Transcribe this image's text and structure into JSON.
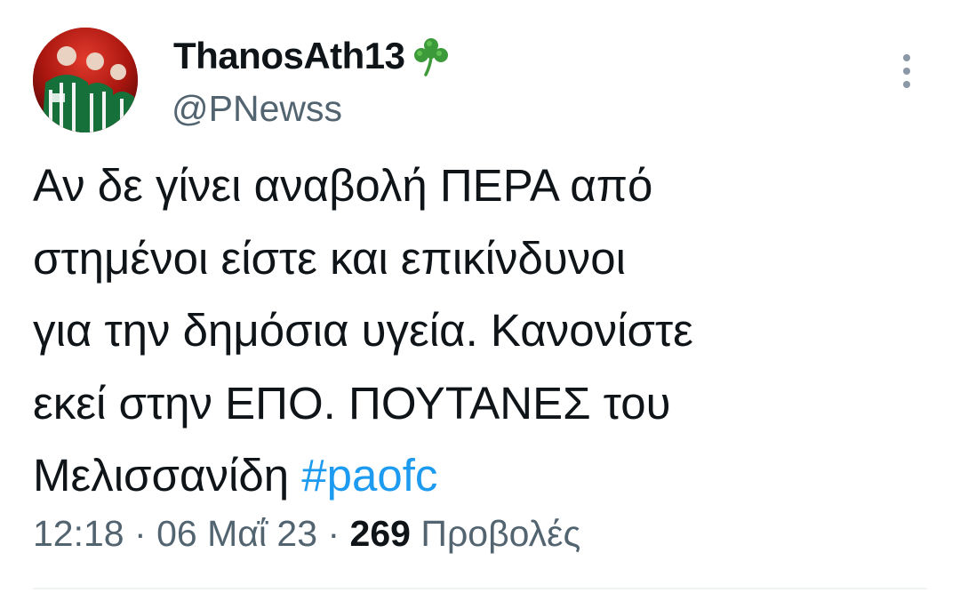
{
  "author": {
    "display_name": "ThanosAth13",
    "name_emoji": "shamrock-icon",
    "handle": "@PNewss"
  },
  "tweet": {
    "lines": [
      "Αν δε γίνει αναβολή ΠΕΡΑ από",
      "στημένοι είστε και επικίνδυνοι",
      "για την δημόσια υγεία. Κανονίστε",
      "εκεί στην ΕΠΟ. ΠΟΥΤΑΝΕΣ του",
      "Μελισσανίδη"
    ],
    "hashtag": "#paofc"
  },
  "meta": {
    "time": "12:18",
    "separator": "·",
    "date": "06 Μαΐ 23",
    "views_count": "269",
    "views_label": "Προβολές"
  },
  "colors": {
    "text": "#0f1419",
    "secondary": "#536471",
    "link": "#1d9bf0",
    "divider": "#eff3f4"
  }
}
